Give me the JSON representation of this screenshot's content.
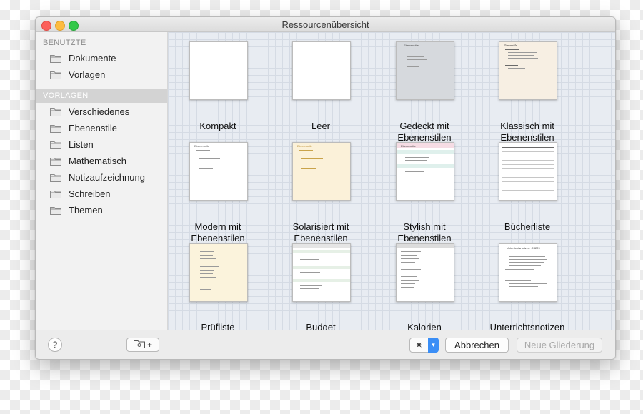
{
  "window": {
    "title": "Ressourcenübersicht"
  },
  "sidebar": {
    "section1": "BENUTZTE",
    "section1_items": [
      {
        "label": "Dokumente",
        "icon": "folder-icon"
      },
      {
        "label": "Vorlagen",
        "icon": "folder-icon"
      }
    ],
    "section2": "VORLAGEN",
    "section2_items": [
      {
        "label": "Verschiedenes",
        "icon": "folder-icon"
      },
      {
        "label": "Ebenenstile",
        "icon": "folder-icon"
      },
      {
        "label": "Listen",
        "icon": "folder-icon"
      },
      {
        "label": "Mathematisch",
        "icon": "folder-icon"
      },
      {
        "label": "Notizaufzeichnung",
        "icon": "folder-icon"
      },
      {
        "label": "Schreiben",
        "icon": "folder-icon"
      },
      {
        "label": "Themen",
        "icon": "folder-icon"
      }
    ]
  },
  "templates": [
    {
      "label1": "Kompakt",
      "label2": ""
    },
    {
      "label1": "Leer",
      "label2": ""
    },
    {
      "label1": "Gedeckt mit",
      "label2": "Ebenenstilen"
    },
    {
      "label1": "Klassisch mit",
      "label2": "Ebenenstilen"
    },
    {
      "label1": "Modern mit",
      "label2": "Ebenenstilen"
    },
    {
      "label1": "Solarisiert mit",
      "label2": "Ebenenstilen"
    },
    {
      "label1": "Stylish mit",
      "label2": "Ebenenstilen"
    },
    {
      "label1": "Bücherliste",
      "label2": ""
    },
    {
      "label1": "Prüfliste",
      "label2": ""
    },
    {
      "label1": "Budget",
      "label2": ""
    },
    {
      "label1": "Kalorien",
      "label2": ""
    },
    {
      "label1": "Unterrichtsnotizen",
      "label2": ""
    }
  ],
  "thumbnail_text": {
    "gedeckt": "Ebenenstile",
    "klassisch": "Ebenenstile",
    "modern": "Ebenenstile",
    "solarisiert": "Ebenenstile",
    "stylish": "Ebenenstile",
    "unterricht": "Unterrichtsnotizen: CS229"
  },
  "bottombar": {
    "help_label": "?",
    "new_folder_label": "+",
    "gear_icon": "gear-icon",
    "cancel_label": "Abbrechen",
    "new_outline_label": "Neue Gliederung"
  },
  "colors": {
    "selected_sidebar": "#d3d3d3",
    "accent": "#3a8ef6",
    "gallery_bg": "#e8ecf2",
    "gedeckt_bg": "#d6d9dd",
    "klassisch_bg": "#f7efe3",
    "solarisiert_bg": "#fbf1d9",
    "pruefliste_bg": "#fbf3dc"
  }
}
